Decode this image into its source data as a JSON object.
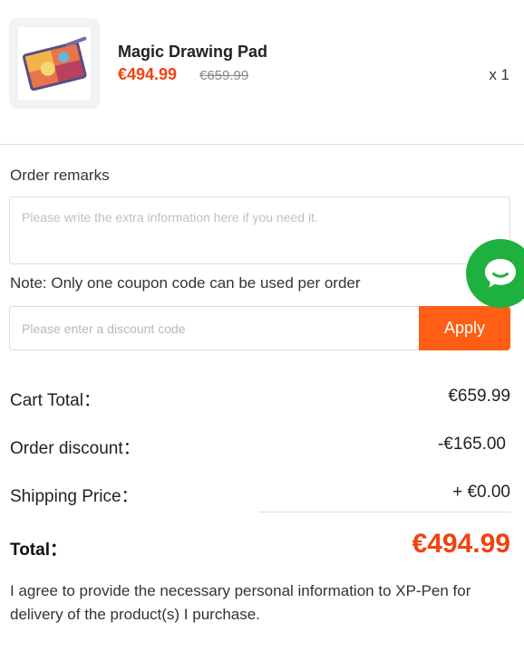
{
  "product": {
    "name": "Magic Drawing Pad",
    "price": "€494.99",
    "original_price": "€659.99",
    "quantity": "x 1",
    "image": "drawing-tablet-image"
  },
  "remarks": {
    "label": "Order remarks",
    "placeholder": "Please write the extra information here if you need it."
  },
  "coupon": {
    "note": "Note: Only one coupon code can be used per order",
    "placeholder": "Please enter a discount code",
    "apply_label": "Apply"
  },
  "summary": {
    "cart_total_label": "Cart Total：",
    "cart_total_value": "€659.99",
    "discount_label": "Order discount：",
    "discount_value": "-€165.00",
    "shipping_label": "Shipping Price：",
    "shipping_value": "+ €0.00",
    "total_label": "Total：",
    "total_value": "€494.99"
  },
  "agreement": "I agree to provide the necessary personal information to XP-Pen for delivery of the product(s) I purchase.",
  "colors": {
    "accent": "#ff5e14",
    "price": "#f0430e",
    "chat": "#1fb13f"
  },
  "icons": {
    "chat": "chat-bubble-icon"
  }
}
